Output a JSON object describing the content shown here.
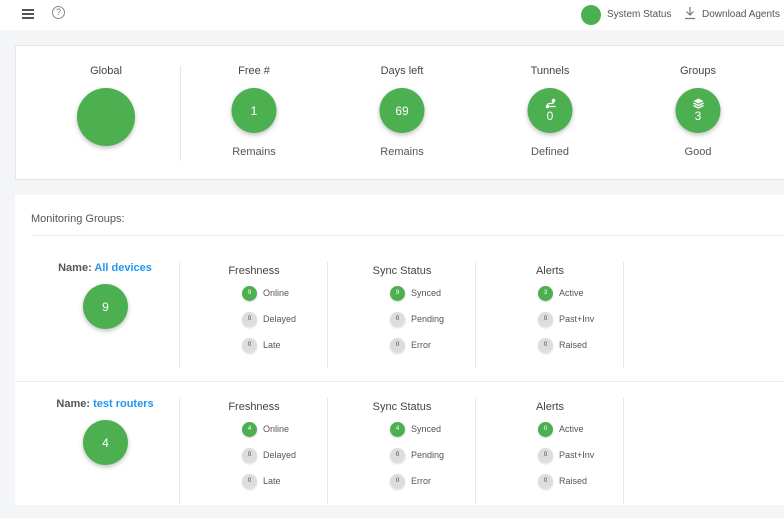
{
  "topbar": {
    "menu_icon": "hamburger-menu-icon",
    "help_icon": "help-circle-icon",
    "help_glyph": "?",
    "system_status_label": "System Status",
    "download_label": "Download Agents",
    "status_color": "#4caf50"
  },
  "summary": {
    "global": {
      "title": "Global"
    },
    "free": {
      "title": "Free #",
      "value": "1",
      "sub": "Remains"
    },
    "days": {
      "title": "Days left",
      "value": "69",
      "sub": "Remains"
    },
    "tunnels": {
      "title": "Tunnels",
      "value": "0",
      "sub": "Defined",
      "icon": "route-icon"
    },
    "groups": {
      "title": "Groups",
      "value": "3",
      "sub": "Good",
      "icon": "layers-icon"
    }
  },
  "monitoring": {
    "title": "Monitoring Groups:",
    "groups": [
      {
        "name_prefix": "Name:",
        "name": "All devices",
        "count": "9",
        "freshness": {
          "title": "Freshness",
          "items": [
            {
              "value": "9",
              "label": "Online"
            },
            {
              "value": "0",
              "label": "Delayed"
            },
            {
              "value": "0",
              "label": "Late"
            }
          ]
        },
        "sync": {
          "title": "Sync Status",
          "items": [
            {
              "value": "9",
              "label": "Synced"
            },
            {
              "value": "0",
              "label": "Pending"
            },
            {
              "value": "0",
              "label": "Error"
            }
          ]
        },
        "alerts": {
          "title": "Alerts",
          "items": [
            {
              "value": "3",
              "label": "Active"
            },
            {
              "value": "0",
              "label": "Past+Inv"
            },
            {
              "value": "0",
              "label": "Raised"
            }
          ]
        }
      },
      {
        "name_prefix": "Name:",
        "name": "test routers",
        "count": "4",
        "freshness": {
          "title": "Freshness",
          "items": [
            {
              "value": "4",
              "label": "Online"
            },
            {
              "value": "0",
              "label": "Delayed"
            },
            {
              "value": "0",
              "label": "Late"
            }
          ]
        },
        "sync": {
          "title": "Sync Status",
          "items": [
            {
              "value": "4",
              "label": "Synced"
            },
            {
              "value": "0",
              "label": "Pending"
            },
            {
              "value": "0",
              "label": "Error"
            }
          ]
        },
        "alerts": {
          "title": "Alerts",
          "items": [
            {
              "value": "0",
              "label": "Active"
            },
            {
              "value": "0",
              "label": "Past+Inv"
            },
            {
              "value": "0",
              "label": "Raised"
            }
          ]
        }
      }
    ]
  }
}
